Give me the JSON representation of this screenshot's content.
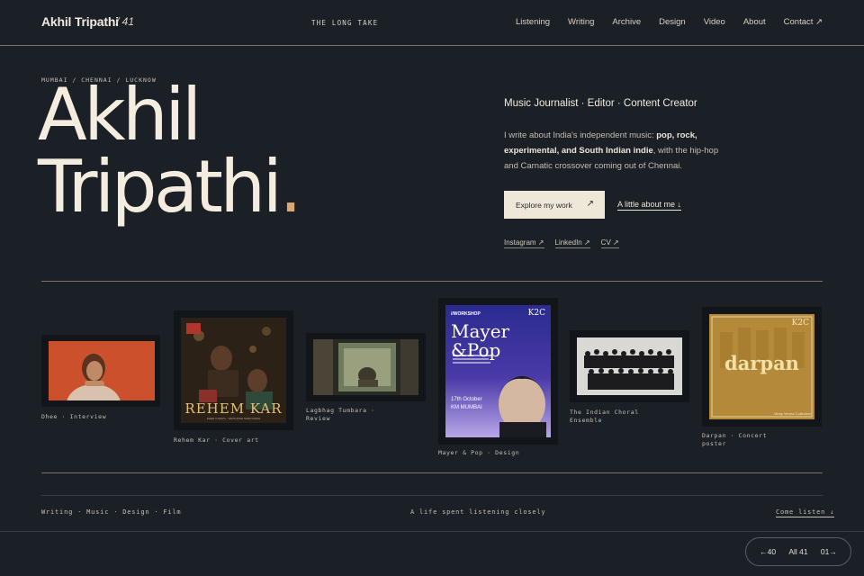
{
  "header": {
    "brand": "Akhil Tripathi",
    "number": "/ 41",
    "tagline": "THE LONG TAKE",
    "nav": [
      "Listening",
      "Writing",
      "Archive",
      "Design",
      "Video",
      "About",
      "Contact ↗"
    ]
  },
  "hero": {
    "cities": "MUMBAI / CHENNAI / LUCKNOW",
    "name_line1": "Akhil",
    "name_line2": "Tripathi",
    "name_dot": ".",
    "role": "Music Journalist · Editor · Content Creator",
    "bio_1": "I write about India's independent music: ",
    "bio_bold": "pop, rock, experimental, and South Indian indie",
    "bio_2": ", with the hip-hop and Carnatic crossover coming out of Chennai.",
    "primary_button": "Explore my work",
    "primary_arrow": "↗",
    "about_link": "A little about me ↓",
    "socials": [
      "Instagram ↗",
      "LinkedIn ↗",
      "CV ↗"
    ]
  },
  "gallery": [
    {
      "caption": "Dhee · Interview"
    },
    {
      "caption": "Rehem Kar · Cover art",
      "art_title": "REHEM KAR",
      "art_sub": "DHEE X ARIVU  ·  SANTHOSH NARAYANAN"
    },
    {
      "caption_1": "Lagbhag Tumbara ·",
      "caption_2": "Review"
    },
    {
      "caption": "Mayer & Pop · Design",
      "tag": "//WORKSHOP",
      "logo": "K2C",
      "title_1": "Mayer",
      "title_2": "&Pop",
      "date": "17th October",
      "venue": "KM MUMBAI"
    },
    {
      "caption_1": "The Indian Choral",
      "caption_2": "Ensemble"
    },
    {
      "caption_1": "Darpan · Concert",
      "caption_2": "poster",
      "logo": "K2C",
      "art_title": "darpan",
      "art_sub": "Vinay Verma Collective"
    }
  ],
  "footer": {
    "left": "Writing · Music · Design · Film",
    "center": "A life spent listening closely",
    "right": "Come listen ↓"
  },
  "pager": {
    "prev": "←40",
    "all": "All 41",
    "next": "01→"
  }
}
